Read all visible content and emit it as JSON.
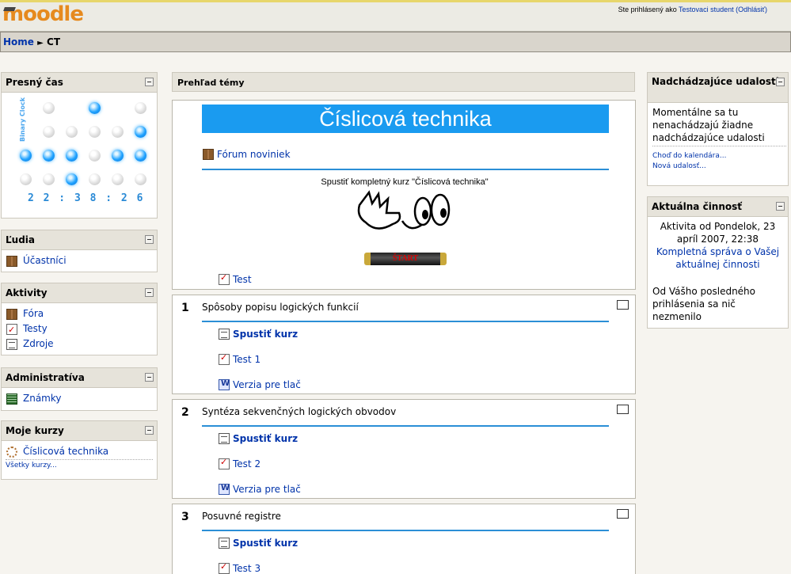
{
  "header": {
    "logo_text": "moodle",
    "login_prefix": "Ste prihlásený ako",
    "login_user": "Testovaci student",
    "logout_label": "(Odhlásiť)"
  },
  "navbar": {
    "home_label": "Home",
    "separator": "►",
    "current": "CT"
  },
  "left": {
    "clock": {
      "title": "Presný čas",
      "side_label": "Binary Clock",
      "time": "2 2 : 3 8 : 2 6"
    },
    "people": {
      "title": "Ľudia",
      "items": [
        "Účastníci"
      ]
    },
    "activities": {
      "title": "Aktivity",
      "items": [
        "Fóra",
        "Testy",
        "Zdroje"
      ]
    },
    "admin": {
      "title": "Administratíva",
      "items": [
        "Známky"
      ]
    },
    "mycourses": {
      "title": "Moje kurzy",
      "items": [
        "Číslicová technika"
      ],
      "all_label": "Všetky kurzy..."
    }
  },
  "center": {
    "title": "Prehľad témy",
    "topic0": {
      "banner": "Číslicová technika",
      "forum": "Fórum noviniek",
      "start_text": "Spustiť kompletný kurz \"Číslicová technika\"",
      "start_button": "ŠTART",
      "test": "Test"
    },
    "sections": [
      {
        "num": "1",
        "title": "Spôsoby popisu logických funkcií",
        "run": "Spustiť kurz",
        "test": "Test 1",
        "print": "Verzia pre tlač"
      },
      {
        "num": "2",
        "title": "Syntéza sekvenčných logických obvodov",
        "run": "Spustiť kurz",
        "test": "Test 2",
        "print": "Verzia pre tlač"
      },
      {
        "num": "3",
        "title": "Posuvné registre",
        "run": "Spustiť kurz",
        "test": "Test 3"
      }
    ]
  },
  "right": {
    "events": {
      "title": "Nadchádzajúce udalosti",
      "body": "Momentálne sa tu nenachádzajú žiadne nadchádzajúce udalosti",
      "calendar_link": "Choď do kalendára...",
      "new_event_link": "Nová udalosť..."
    },
    "activity": {
      "title": "Aktuálna činnosť",
      "since": "Aktivita od Pondelok, 23 apríl 2007, 22:38",
      "report_link": "Kompletná správa o Vašej aktuálnej činnosti",
      "nothing": "Od Vášho posledného prihlásenia sa nič nezmenilo"
    }
  }
}
